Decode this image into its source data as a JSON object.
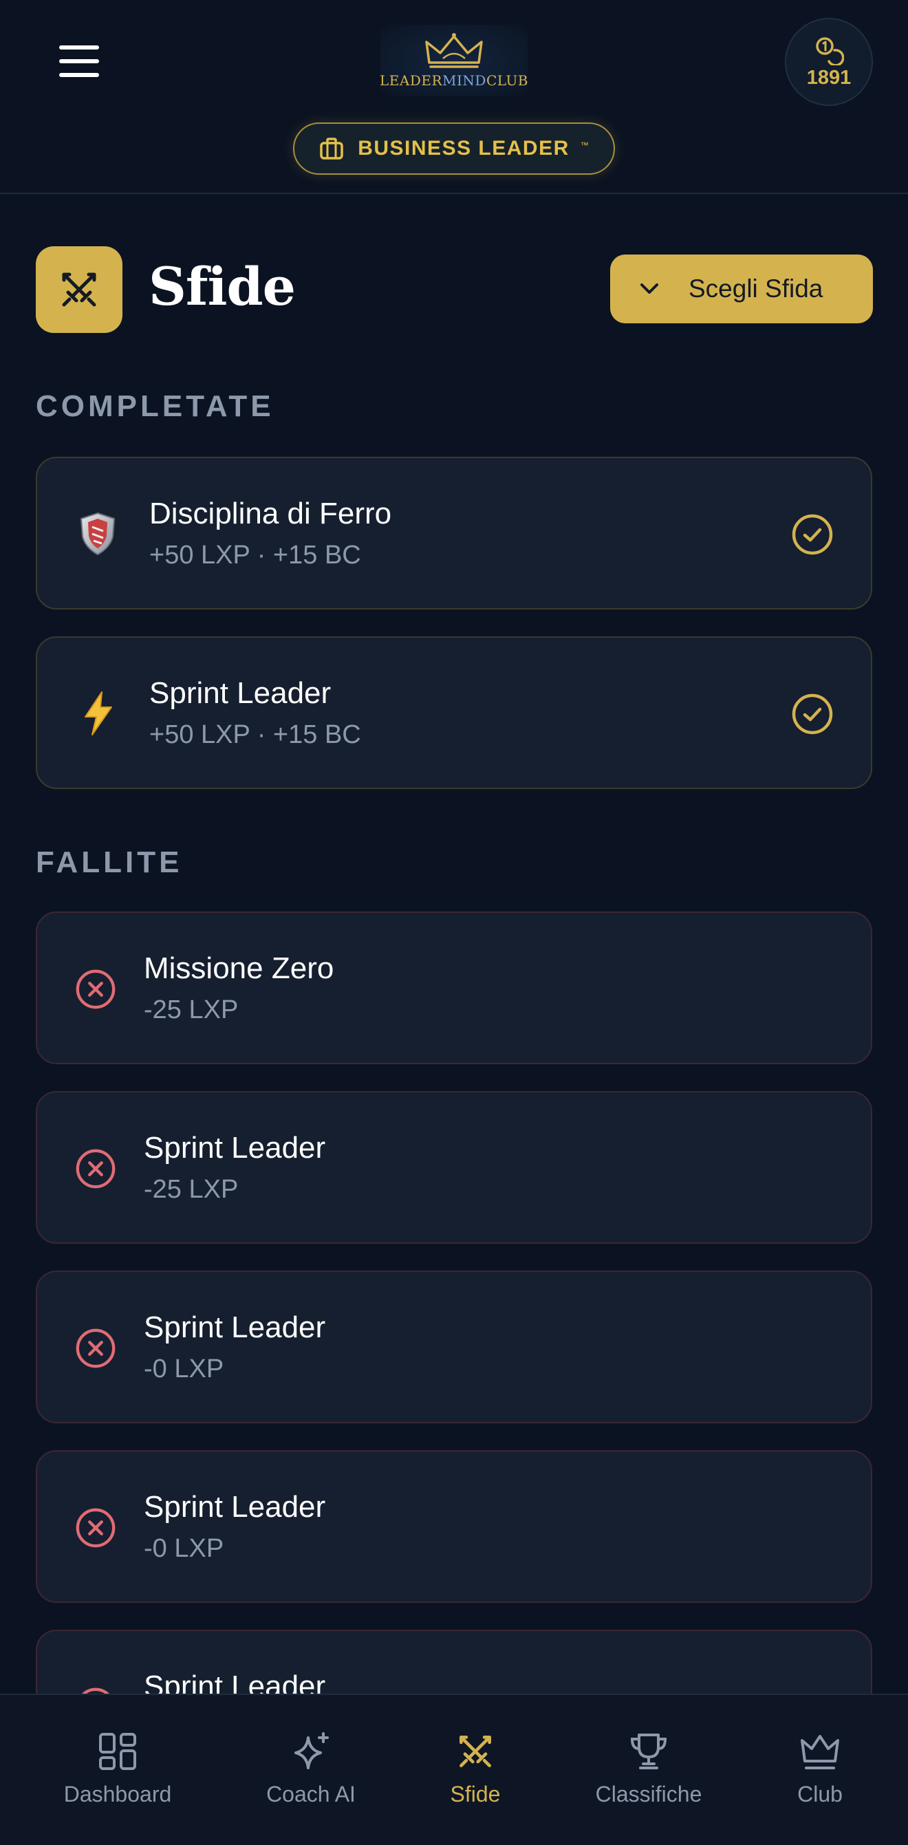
{
  "header": {
    "logo_prefix": "LEADER",
    "logo_middle": "MIND",
    "logo_suffix": "CLUB",
    "coins": "1891",
    "role": "BUSINESS LEADER",
    "role_tm": "™",
    "role_icon": "briefcase-icon",
    "menu_icon": "hamburger-icon",
    "coin_icon": "coins-icon"
  },
  "title": {
    "text": "Sfide",
    "icon": "crossed-swords-icon",
    "choose_button": "Scegli Sfida"
  },
  "colors": {
    "accent": "#d4b34f",
    "background": "#0b1322",
    "card": "#161f2f",
    "fail": "#e06c75",
    "muted": "#8d99ab"
  },
  "sections": {
    "completed_label": "COMPLETATE",
    "failed_label": "FALLITE"
  },
  "completed": [
    {
      "title": "Disciplina di Ferro",
      "reward": "+50 LXP · +15 BC",
      "icon": "shield-icon"
    },
    {
      "title": "Sprint Leader",
      "reward": "+50 LXP · +15 BC",
      "icon": "lightning-icon"
    }
  ],
  "failed": [
    {
      "title": "Missione Zero",
      "penalty": "-25 LXP"
    },
    {
      "title": "Sprint Leader",
      "penalty": "-25 LXP"
    },
    {
      "title": "Sprint Leader",
      "penalty": "-0 LXP"
    },
    {
      "title": "Sprint Leader",
      "penalty": "-0 LXP"
    },
    {
      "title": "Sprint Leader",
      "penalty": ""
    }
  ],
  "nav": [
    {
      "label": "Dashboard",
      "icon": "grid-icon"
    },
    {
      "label": "Coach AI",
      "icon": "sparkles-icon"
    },
    {
      "label": "Sfide",
      "icon": "crossed-swords-icon",
      "active": true
    },
    {
      "label": "Classifiche",
      "icon": "trophy-icon"
    },
    {
      "label": "Club",
      "icon": "crown-icon"
    }
  ]
}
